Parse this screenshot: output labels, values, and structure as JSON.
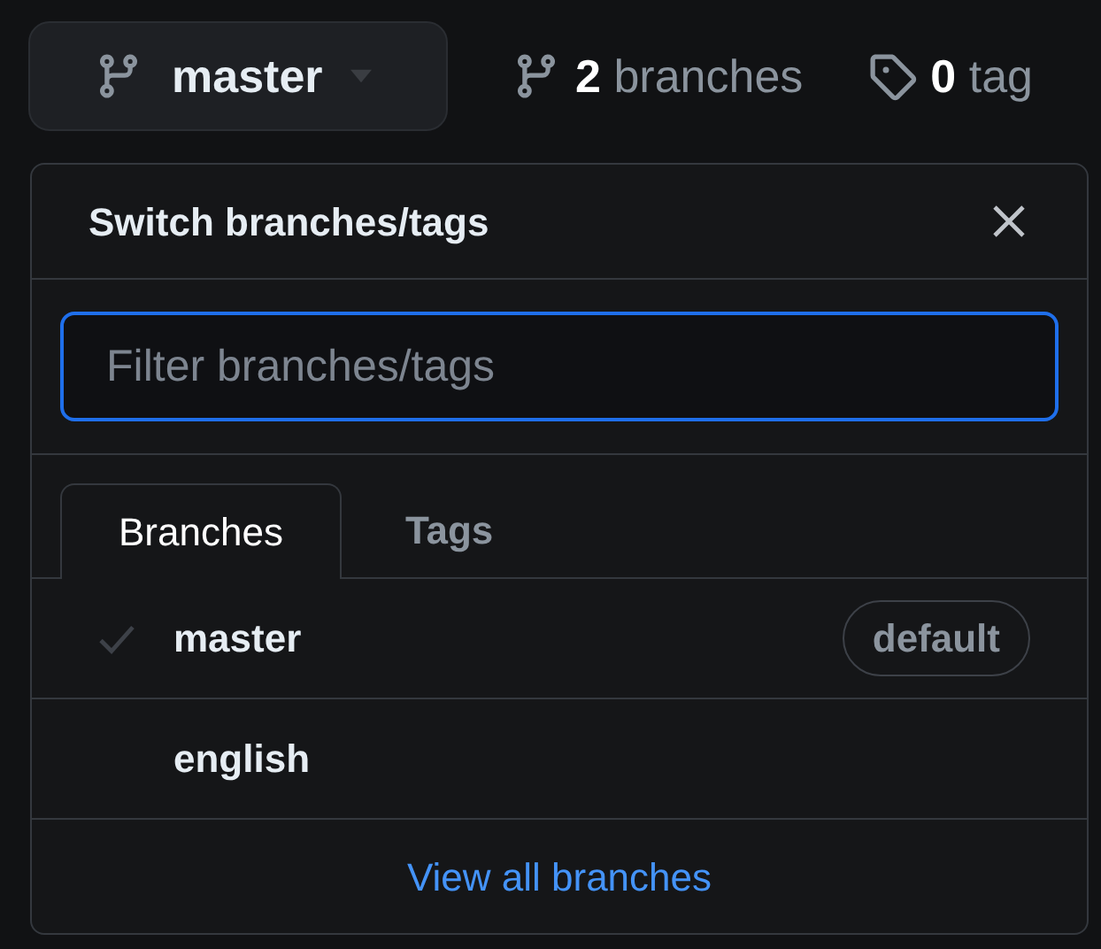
{
  "branch_button": {
    "label": "master"
  },
  "counts": [
    {
      "number": "2",
      "label": "branches",
      "kind": "branch"
    },
    {
      "number": "0",
      "label": "tag",
      "kind": "tag"
    }
  ],
  "popup": {
    "title": "Switch branches/tags",
    "filter": {
      "placeholder": "Filter branches/tags"
    },
    "tabs": [
      {
        "label": "Branches",
        "selected": true
      },
      {
        "label": "Tags",
        "selected": false
      }
    ],
    "branches": [
      {
        "name": "master",
        "selected": true,
        "badge": "default"
      },
      {
        "name": "english",
        "selected": false
      }
    ],
    "footer_link": "View all branches"
  }
}
